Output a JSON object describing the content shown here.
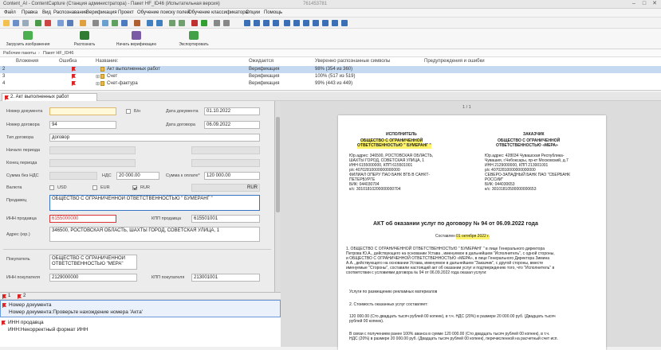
{
  "window": {
    "title": "Content_AI - ContentCapture (Станция администратора) - Пакет HF_ID46 (Испытательная версия)",
    "center_caption": "761453781"
  },
  "menu": [
    "Файл",
    "Правка",
    "Вид",
    "Распознавание",
    "Верификация",
    "Проект",
    "Обучение поиску полей",
    "Обучение классификатора",
    "Опции",
    "Помощь"
  ],
  "ribbon": {
    "load": "Загрузить изображения",
    "recognize": "Распознать",
    "verify": "Начать верификацию",
    "export": "Экспортировать"
  },
  "breadcrumb": [
    "Рабочие пакеты",
    "Пакет HF_ID46"
  ],
  "grid": {
    "headers": [
      "Вложения",
      "Ошибка",
      "Название:",
      "Ожидается",
      "Уверенно распознанные символы",
      "Предупреждения и ошибки"
    ],
    "rows": [
      {
        "num": "2",
        "name": "Акт выполненных работ",
        "status": "Верификация",
        "conf": "98% (354 из 360)"
      },
      {
        "num": "3",
        "name": "Счет",
        "status": "Верификация",
        "conf": "100% (517 из 519)"
      },
      {
        "num": "4",
        "name": "Счет-фактура",
        "status": "Верификация",
        "conf": "99% (443 из 449)"
      }
    ]
  },
  "tab": {
    "label": "2. Акт выполненных работ"
  },
  "form": {
    "doc_number_label": "Номер документа",
    "doc_number_value": "",
    "bn_label": "Б/н",
    "doc_date_label": "Дата документа",
    "doc_date_value": "01.10.2022",
    "contract_number_label": "Номер договора",
    "contract_number_value": "94",
    "contract_date_label": "Дата договора",
    "contract_date_value": "06.09.2022",
    "contract_type_label": "Тип договора",
    "contract_type_value": "договор",
    "period_start_label": "Начало периода",
    "period_end_label": "Конец периода",
    "sum_no_vat_label": "Сумма без НДС",
    "vat_label": "НДС",
    "vat_value": "20 000.00",
    "sum_total_label": "Сумма к оплате*",
    "sum_total_value": "120 000.00",
    "currency_label": "Валюта",
    "usd": "USD",
    "eur": "EUR",
    "rur": "RUR",
    "rur_code": "RUR",
    "seller_label": "Продавец",
    "seller_value": "ОБЩЕСТВО С ОГРАНИЧЕННОЙ ОТВЕТСТВЕННОСТЬЮ \" БУМЕРАНГ \"",
    "seller_inn_label": "ИНН продавца",
    "seller_inn_value": "6155000000",
    "seller_kpp_label": "КПП продавца",
    "seller_kpp_value": "615501001",
    "address_label": "Адрес (юр.)",
    "address_value": "346500, РОСТОВСКАЯ ОБЛАСТЬ, ШАХТЫ ГОРОД, СОВЕТСКАЯ УЛИЦА, 1",
    "buyer_label": "Покупатель",
    "buyer_value": "ОБЩЕСТВО С ОГРАНИЧЕННОЙ ОТВЕТСТВЕННОСТЬЮ \"МЕРА\"",
    "buyer_inn_label": "ИНН покупателя",
    "buyer_inn_value": "2129000000",
    "buyer_kpp_label": "КПП покупателя",
    "buyer_kpp_value": "213001001"
  },
  "messages": {
    "tab_count_1": "1",
    "tab_count_2": "2",
    "items": [
      {
        "title": "Номер документа",
        "text": "Номер документа:Проверьте нахождение номера 'Акта'"
      },
      {
        "title": "ИНН продавца",
        "text": "ИНН:Некорректный формат ИНН"
      }
    ]
  },
  "document": {
    "page_counter": "1 / 1",
    "executor_title": "ИСПОЛНИТЕЛЬ",
    "executor_name_1": "ОБЩЕСТВО С ОГРАНИЧЕННОЙ",
    "executor_name_2": "ОТВЕТСТВЕННОСТЬЮ \" БУМЕРАНГ \"",
    "executor_addr_1": "Юр.адрес: 346500, РОСТОВСКАЯ ОБЛАСТЬ,",
    "executor_addr_2": "ШАХТЫ ГОРОД, СОВЕТСКАЯ УЛИЦА, 1",
    "executor_inn": "ИНН 6155000000, КПП 615501001",
    "executor_rs": "р/с 40702810000000000000",
    "executor_bank_1": "ФИЛИАЛ ОПЕРУ ПАО БАНК ВТБ В САНКТ-",
    "executor_bank_2": "ПЕТЕРБУРГЕ",
    "executor_bik": "БИК: 044030704",
    "executor_ks": "к/с: 30101810200000000704",
    "customer_title": "ЗАКАЗЧИК",
    "customer_name_1": "ОБЩЕСТВО С ОГРАНИЧЕННОЙ",
    "customer_name_2": "ОТВЕТСТВЕННОСТЬЮ «МЕРА»",
    "customer_addr_1": "Юр.адрес: 428034 Чувашская Республика-",
    "customer_addr_2": "Чувашия, г.Чебоксары, пр-кт Московский, д.7",
    "customer_inn": "ИНН 2129000000, КПП 213001001",
    "customer_rs": "р/с 40702810000000000000",
    "customer_bank_1": "СЕВЕРО-ЗАПАДНЫЙ БАНК ПАО \"СБЕРБАНК",
    "customer_bank_2": "РОССИИ\"",
    "customer_bik": "БИК: 044030653",
    "customer_ks": "к/с: 30101810500000000653",
    "act_title": "АКТ об оказании услуг по договору № 94 от 06.09.2022 года",
    "composed_label": "Составлен",
    "composed_date": "01 октября 2022 г.",
    "p1": [
      "1. ОБЩЕСТВО С ОГРАНИЧЕННОЙ ОТВЕТСТВЕННОСТЬЮ \" БУМЕРАНГ \" в лице Генерального директора",
      "Петрова Ю.А., действующего на основании Устава , именуемое в дальнейшем \"Исполнитель\", с одной стороны,",
      "и ОБЩЕСТВО С ОГРАНИЧЕННОЙ ОТВЕТСТВЕННОСТЬЮ «МЕРА», в лице Генерального Директора Зимина",
      "А.А., действующего на основании Устава, именуемое в дальнейшем \"Заказчик\", с другой стороны, вместе",
      "именуемые \"Стороны\", составили настоящий акт об оказании услуг и подтверждению того, что \"Исполнитель\" в",
      "соответствии с условиями договора № 94 от 06.09.2022 года  оказал услуги:"
    ],
    "services": "Услуги по размещению рекламных материалов",
    "p2": "2. Стоимость оказанных услуг составляет:",
    "p3": [
      "120 000.00 (Сто двадцать тысяч рублей 00 копеек), в т.ч. НДС (20%) в размере 20 000.00 руб. (Двадцать тысяч",
      "рублей 00 копеек)."
    ],
    "p4": [
      "В связи с получением ранее 100% аванса в сумме 120 000.00 (Сто двадцать тысяч рублей 00 копеек), в т.ч.",
      "НДС (20%) в размере 20 000.00 руб. (Двадцать тысяч рублей 00 копеек), перечисленной на расчетный счет исп."
    ]
  },
  "colors": {
    "selected_row": "#c5d9f0",
    "flag": "#dd2222",
    "highlight": "#fff36b",
    "focus_border": "#3574c4"
  }
}
